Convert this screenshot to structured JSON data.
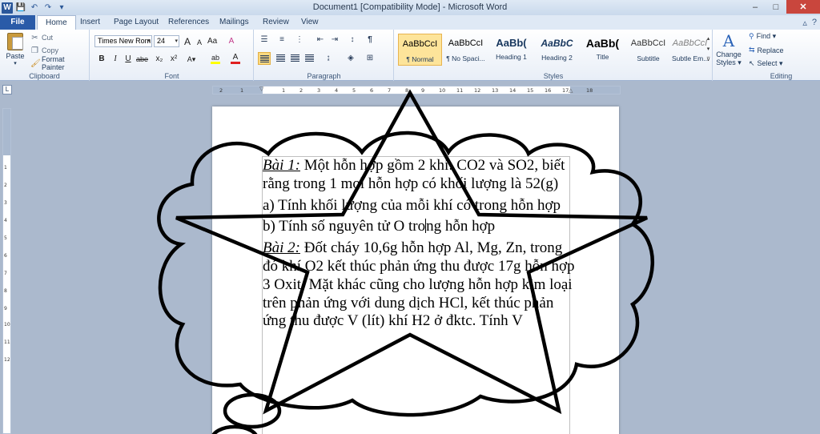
{
  "window": {
    "title": "Document1 [Compatibility Mode] - Microsoft Word",
    "quick_access": [
      "W",
      "💾",
      "↶",
      "↷"
    ]
  },
  "tabs": [
    {
      "label": "File"
    },
    {
      "label": "Home"
    },
    {
      "label": "Insert"
    },
    {
      "label": "Page Layout"
    },
    {
      "label": "References"
    },
    {
      "label": "Mailings"
    },
    {
      "label": "Review"
    },
    {
      "label": "View"
    }
  ],
  "ribbon": {
    "clipboard": {
      "label": "Clipboard",
      "paste": "Paste",
      "cut": "Cut",
      "copy": "Copy",
      "format_painter": "Format Painter"
    },
    "font": {
      "label": "Font",
      "font_name": "Times New Rom",
      "font_size": "24",
      "grow": "A",
      "shrink": "A",
      "case": "Aa",
      "clear": "A",
      "bold": "B",
      "italic": "I",
      "underline": "U",
      "strike": "abe",
      "subscript": "x₂",
      "superscript": "x²",
      "highlight": "ab",
      "font_color": "A"
    },
    "paragraph": {
      "label": "Paragraph",
      "pilcrow": "¶"
    },
    "styles": {
      "label": "Styles",
      "items": [
        {
          "sample": "AaBbCcI",
          "name": "¶ Normal"
        },
        {
          "sample": "AaBbCcI",
          "name": "¶ No Spaci..."
        },
        {
          "sample": "AaBb(",
          "name": "Heading 1"
        },
        {
          "sample": "AaBbC",
          "name": "Heading 2"
        },
        {
          "sample": "AaBb(",
          "name": "Title"
        },
        {
          "sample": "AaBbCcI",
          "name": "Subtitle"
        },
        {
          "sample": "AaBbCcI",
          "name": "Subtle Em..."
        }
      ],
      "change_styles_line1": "Change",
      "change_styles_line2": "Styles ▾"
    },
    "editing": {
      "label": "Editing",
      "find": "Find ▾",
      "replace": "Replace",
      "select": "Select ▾"
    }
  },
  "ruler": {
    "h_ticks": [
      "2",
      "1",
      "1",
      "2",
      "3",
      "4",
      "5",
      "6",
      "7",
      "8",
      "9",
      "10",
      "11",
      "12",
      "13",
      "14",
      "15",
      "16",
      "17",
      "18"
    ],
    "v_ticks": [
      "1",
      "2",
      "3",
      "4",
      "5",
      "6",
      "7",
      "8",
      "9",
      "10",
      "11",
      "12"
    ]
  },
  "document": {
    "p1_label": "Bài 1:",
    "p1_text": " Một hỗn hợp gồm 2 khí: CO2 và SO2, biết rằng trong 1 mol hỗn hợp có khối lượng là 52(g)",
    "p2_text": "a) Tính khối lượng của mỗi khí có trong hỗn hợp",
    "p3_before": "b) Tính số nguyên tử O tro",
    "p3_after": "ng hỗn hợp",
    "p4_label": "Bài 2:",
    "p4_text": " Đốt cháy 10,6g hỗn hợp Al, Mg, Zn, trong đó khí O2 kết thúc phản ứng thu được 17g hỗn hợp 3 Oxit. Mặt khác cũng cho lượng hỗn hợp kim loại trên phản ứng với dung dịch HCl, kết thúc phản ứng thu được V (lít) khí H2 ở đktc. Tính V"
  },
  "colors": {
    "file_tab": "#2a5ba8",
    "highlight": "#fbd981",
    "font_color_bar": "#e02020",
    "highlight_bar": "#ffff00"
  }
}
